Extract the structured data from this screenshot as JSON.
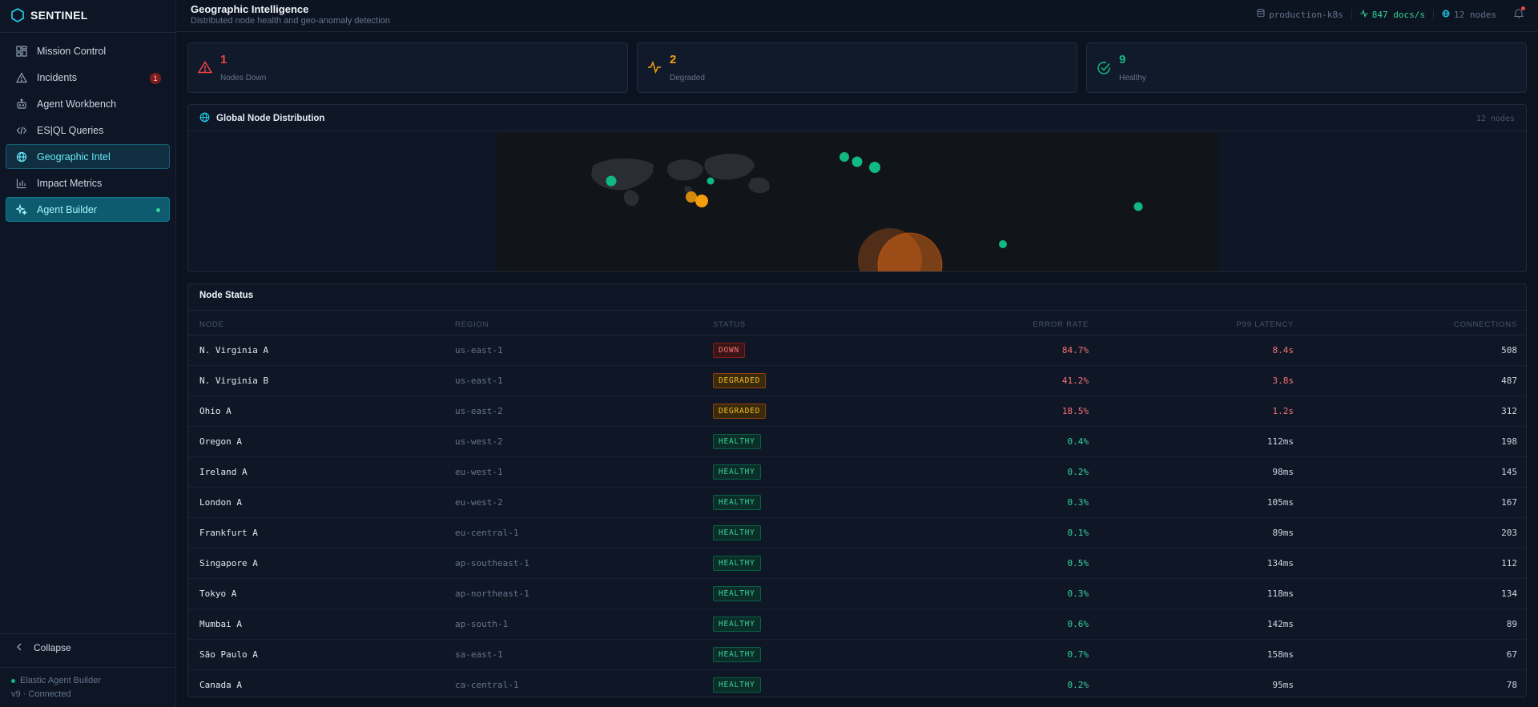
{
  "brand": {
    "name": "SENTINEL"
  },
  "nav": {
    "items": [
      {
        "label": "Mission Control",
        "icon": "dashboard-icon"
      },
      {
        "label": "Incidents",
        "icon": "alert-triangle-icon",
        "badge": "1"
      },
      {
        "label": "Agent Workbench",
        "icon": "robot-icon"
      },
      {
        "label": "ES|QL Queries",
        "icon": "code-icon"
      },
      {
        "label": "Geographic Intel",
        "icon": "globe-icon",
        "active": true
      },
      {
        "label": "Impact Metrics",
        "icon": "bar-chart-icon"
      },
      {
        "label": "Agent Builder",
        "icon": "sparkle-icon",
        "highlight": true
      }
    ],
    "collapse_label": "Collapse"
  },
  "footer": {
    "line1": "Elastic Agent Builder",
    "line2": "v9 · Connected"
  },
  "header": {
    "title": "Geographic Intelligence",
    "subtitle": "Distributed node health and geo-anomaly detection",
    "cluster": "production-k8s",
    "throughput": "847 docs/s",
    "node_count": "12 nodes"
  },
  "stats": [
    {
      "value": "1",
      "label": "Nodes Down",
      "color": "#ef4444",
      "icon": "alert-triangle-icon"
    },
    {
      "value": "2",
      "label": "Degraded",
      "color": "#f59e0b",
      "icon": "activity-icon"
    },
    {
      "value": "9",
      "label": "Healthy",
      "color": "#10b981",
      "icon": "check-circle-icon"
    }
  ],
  "map": {
    "title": "Global Node Distribution",
    "count": "12 nodes",
    "status_colors": {
      "healthy": "#10b981",
      "degraded": "#f59e0b",
      "down": "#f97316"
    }
  },
  "table": {
    "title": "Node Status",
    "columns": [
      "NODE",
      "REGION",
      "STATUS",
      "ERROR RATE",
      "P99 LATENCY",
      "CONNECTIONS"
    ],
    "rows": [
      {
        "node": "N. Virginia A",
        "region": "us-east-1",
        "status": "DOWN",
        "error_rate": "84.7%",
        "latency": "8.4s",
        "connections": "508"
      },
      {
        "node": "N. Virginia B",
        "region": "us-east-1",
        "status": "DEGRADED",
        "error_rate": "41.2%",
        "latency": "3.8s",
        "connections": "487"
      },
      {
        "node": "Ohio A",
        "region": "us-east-2",
        "status": "DEGRADED",
        "error_rate": "18.5%",
        "latency": "1.2s",
        "connections": "312"
      },
      {
        "node": "Oregon A",
        "region": "us-west-2",
        "status": "HEALTHY",
        "error_rate": "0.4%",
        "latency": "112ms",
        "connections": "198"
      },
      {
        "node": "Ireland A",
        "region": "eu-west-1",
        "status": "HEALTHY",
        "error_rate": "0.2%",
        "latency": "98ms",
        "connections": "145"
      },
      {
        "node": "London A",
        "region": "eu-west-2",
        "status": "HEALTHY",
        "error_rate": "0.3%",
        "latency": "105ms",
        "connections": "167"
      },
      {
        "node": "Frankfurt A",
        "region": "eu-central-1",
        "status": "HEALTHY",
        "error_rate": "0.1%",
        "latency": "89ms",
        "connections": "203"
      },
      {
        "node": "Singapore A",
        "region": "ap-southeast-1",
        "status": "HEALTHY",
        "error_rate": "0.5%",
        "latency": "134ms",
        "connections": "112"
      },
      {
        "node": "Tokyo A",
        "region": "ap-northeast-1",
        "status": "HEALTHY",
        "error_rate": "0.3%",
        "latency": "118ms",
        "connections": "134"
      },
      {
        "node": "Mumbai A",
        "region": "ap-south-1",
        "status": "HEALTHY",
        "error_rate": "0.6%",
        "latency": "142ms",
        "connections": "89"
      },
      {
        "node": "São Paulo A",
        "region": "sa-east-1",
        "status": "HEALTHY",
        "error_rate": "0.7%",
        "latency": "158ms",
        "connections": "67"
      },
      {
        "node": "Canada A",
        "region": "ca-central-1",
        "status": "HEALTHY",
        "error_rate": "0.2%",
        "latency": "95ms",
        "connections": "78"
      }
    ]
  }
}
